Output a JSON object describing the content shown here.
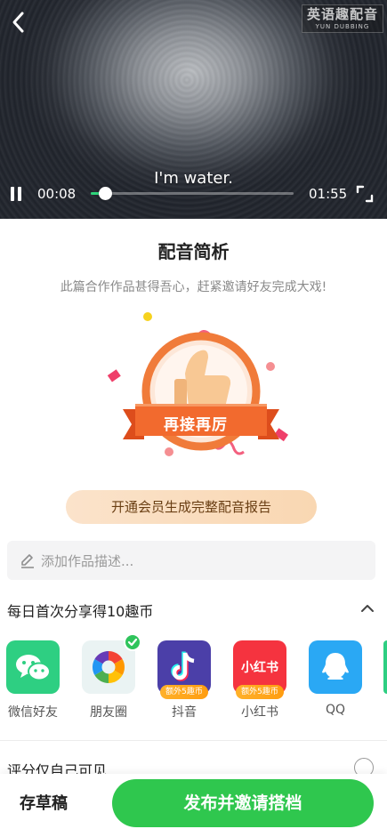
{
  "video": {
    "subtitle": "I'm water.",
    "current_time": "00:08",
    "total_time": "01:55",
    "progress": 0.07,
    "watermark_cn": "英语趣配音",
    "watermark_en": "YUN DUBBING"
  },
  "analysis": {
    "title": "配音简析",
    "subtext": "此篇合作作品甚得吾心，赶紧邀请好友完成大戏!",
    "badge_text": "再接再厉",
    "vip_button": "开通会员生成完整配音报告"
  },
  "description": {
    "placeholder": "添加作品描述..."
  },
  "share": {
    "title": "每日首次分享得10趣币",
    "items": [
      {
        "label": "微信好友",
        "icon": "wechat-icon"
      },
      {
        "label": "朋友圈",
        "icon": "moments-icon",
        "selected": true
      },
      {
        "label": "抖音",
        "icon": "douyin-icon",
        "tag": "额外5趣币"
      },
      {
        "label": "小红书",
        "icon": "xiaohongshu-icon",
        "tag": "额外5趣币",
        "icon_text": "小红书"
      },
      {
        "label": "QQ",
        "icon": "qq-icon"
      }
    ]
  },
  "privacy": {
    "label": "评分仅自己可见"
  },
  "bottom": {
    "draft": "存草稿",
    "publish": "发布并邀请搭档"
  },
  "colors": {
    "accent_green": "#2fc74e",
    "progress_green": "#2ed47a",
    "badge_orange": "#f26a2e",
    "vip_bg": "#f9d7b2"
  }
}
